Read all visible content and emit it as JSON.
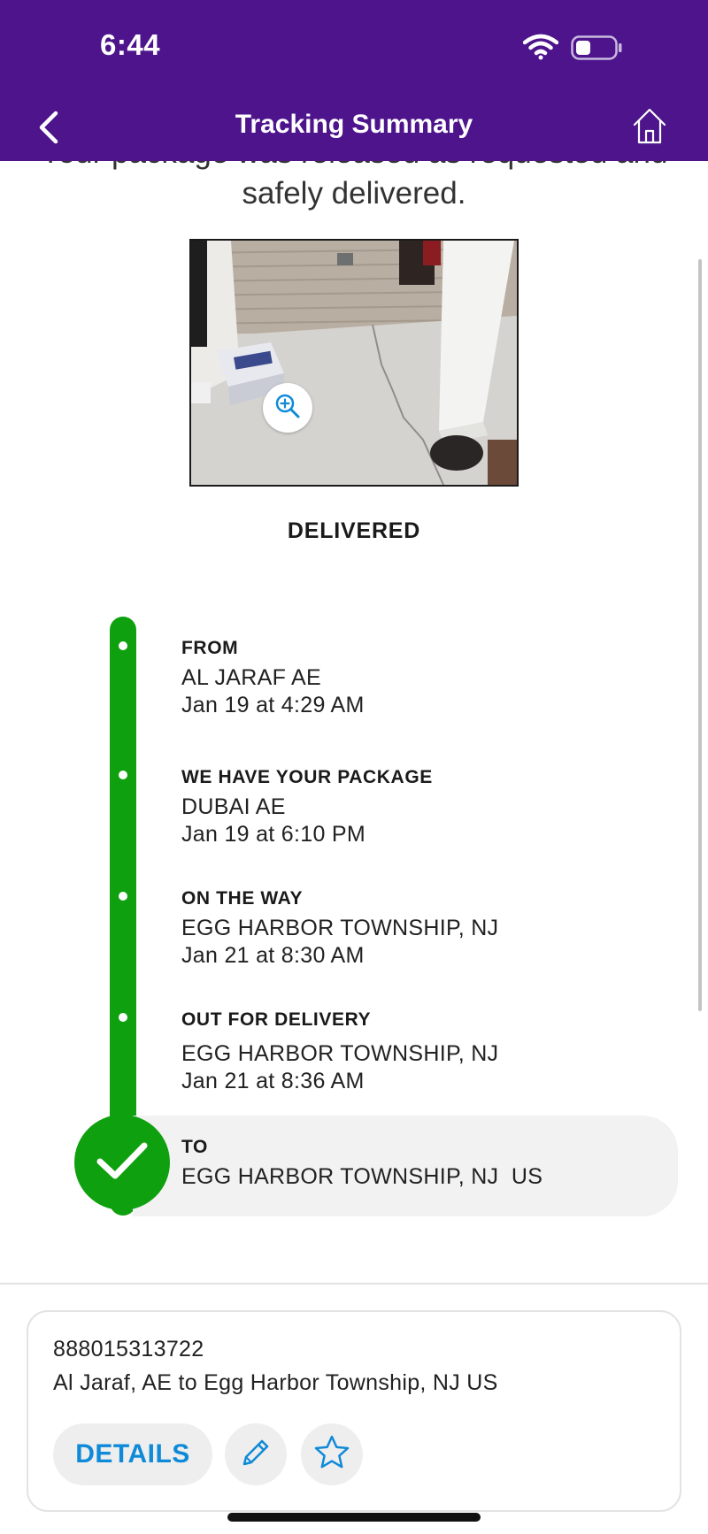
{
  "status_bar": {
    "time": "6:44",
    "wifi_icon": "wifi-icon",
    "battery_icon": "battery-icon"
  },
  "nav": {
    "title": "Tracking Summary",
    "back_icon": "chevron-left-icon",
    "home_icon": "home-icon"
  },
  "delivery_message": "Your package was released as requested and safely delivered.",
  "photo": {
    "zoom_icon": "zoom-in-icon"
  },
  "status": "DELIVERED",
  "timeline": [
    {
      "label": "FROM",
      "location": "AL JARAF AE",
      "time": "Jan 19 at 4:29 AM"
    },
    {
      "label": "WE HAVE YOUR PACKAGE",
      "location": "DUBAI AE",
      "time": "Jan 19 at 6:10 PM"
    },
    {
      "label": "ON THE WAY",
      "location": "EGG HARBOR TOWNSHIP, NJ",
      "time": "Jan 21 at 8:30 AM"
    },
    {
      "label": "OUT FOR DELIVERY",
      "location": "EGG HARBOR TOWNSHIP, NJ",
      "time": "Jan 21 at 8:36 AM"
    },
    {
      "label": "TO",
      "location": "EGG HARBOR TOWNSHIP, NJ  US"
    }
  ],
  "card": {
    "tracking_number": "888015313722",
    "route": "Al Jaraf, AE to Egg Harbor Township, NJ US",
    "details_label": "DETAILS",
    "edit_icon": "pencil-icon",
    "star_icon": "star-icon"
  },
  "colors": {
    "brand_purple": "#4d148c",
    "progress_green": "#0fa00f",
    "link_blue": "#0f8ad8"
  }
}
